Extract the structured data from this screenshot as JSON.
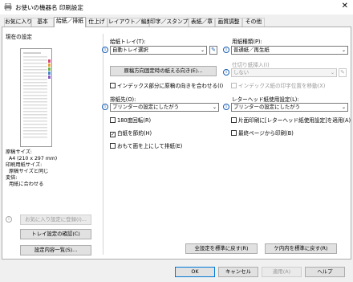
{
  "window": {
    "title": "お使いの機器名 印刷設定",
    "close_glyph": "✕"
  },
  "tabs": [
    {
      "label": "お気に入り"
    },
    {
      "label": "基本"
    },
    {
      "label": "給紙／排紙"
    },
    {
      "label": "仕上げ"
    },
    {
      "label": "レイアウト／編集"
    },
    {
      "label": "印字／スタンプ"
    },
    {
      "label": "表紙／章"
    },
    {
      "label": "画質調整"
    },
    {
      "label": "その他"
    }
  ],
  "left": {
    "current_settings": "現在の設定",
    "summary": [
      "原稿サイズ:",
      "A4 (210 x 297 mm)",
      "印刷用紙サイズ:",
      "原稿サイズと同じ",
      "変倍:",
      "用紙に合わせる"
    ],
    "register_favorite": "お気に入り設定に登録(I)...",
    "check_tray": "トレイ設定の確認(C)",
    "settings_list": "設定内容一覧(S)..."
  },
  "main": {
    "paper_tray_label": "給紙トレイ(T):",
    "paper_tray_value": "自動トレイ選択",
    "paper_type_label": "用紙種類(P):",
    "paper_type_value": "普通紙／再生紙",
    "orientation_button": "原稿方向固定時の紙える向き(E)...",
    "slip_sheet_label": "仕切り紙挿入(I)",
    "slip_sheet_value": "しない",
    "index_align_label": "インデックス部分に原稿の向きを合わせる(I)",
    "index_shift_label": "インデックス紙の印字位置を移動(X)",
    "output_label": "排紙先(O):",
    "output_value": "プリンターの設定にしたがう",
    "letterhead_label": "レターヘッド紙使用設定(L):",
    "letterhead_value": "プリンターの設定にしたがう",
    "rotate180": "180度回転(R)",
    "skip_blank": "白紙を節約(H)",
    "face_up": "おもて面を上にして排紙(E)",
    "one_side_letterhead": "片面印刷に[レターヘッド紙使用設定]を適用(A)",
    "last_page_first": "最終ページから印刷(B)",
    "checked": {
      "index_align": false,
      "index_shift": false,
      "rotate180": false,
      "skip_blank": true,
      "face_up": false,
      "one_side_letterhead": false,
      "last_page_first": false
    },
    "reset_all": "全設定を標準に戻す(R)",
    "reset_tab": "ケ内内を標準に戻す(R)"
  },
  "footer": {
    "ok": "OK",
    "cancel": "キャンセル",
    "apply": "適用(A)",
    "help": "ヘルプ"
  },
  "colors": {
    "accent": "#0078d7",
    "info": "#1a5fb4"
  }
}
